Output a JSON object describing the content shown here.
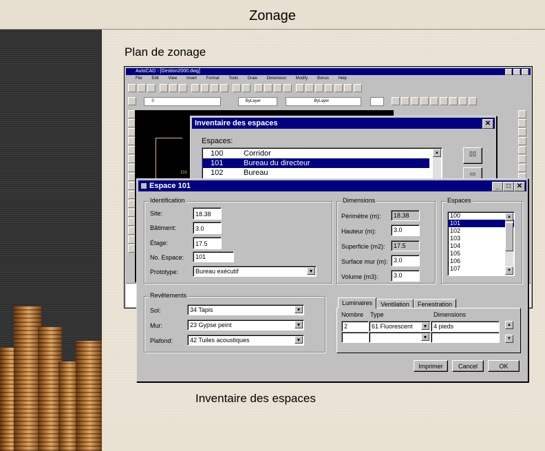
{
  "slide": {
    "title": "Zonage",
    "plan_label": "Plan de zonage",
    "bottom_label": "Inventaire des espaces"
  },
  "autocad": {
    "title": "AutoCAD - [Gestion2000.dwg]",
    "menu": [
      "File",
      "Edit",
      "View",
      "Insert",
      "Format",
      "Tools",
      "Draw",
      "Dimension",
      "Modify",
      "Bonus",
      "Help"
    ],
    "layer_value": "0",
    "linetype_value": "ByLayer",
    "linetype2_value": "ByLayer",
    "color_value": "ByLayer",
    "room_number": "101"
  },
  "inventaire": {
    "title": "Inventaire des espaces",
    "espaces_label": "Espaces:",
    "rows": [
      {
        "num": "100",
        "name": "Corridor"
      },
      {
        "num": "101",
        "name": "Bureau du directeur"
      },
      {
        "num": "102",
        "name": "Bureau"
      }
    ],
    "selected_index": 1
  },
  "espace": {
    "title": "Espace 101",
    "identification": {
      "title": "Identification",
      "site_label": "Site:",
      "site_value": "18.38",
      "batiment_label": "Bâtiment:",
      "batiment_value": "3.0",
      "etage_label": "Étage:",
      "etage_value": "17.5",
      "no_espace_label": "No. Espace:",
      "no_espace_value": "101",
      "prototype_label": "Prototype:",
      "prototype_value": "Bureau exécutif"
    },
    "dimensions": {
      "title": "Dimensions",
      "perimetre_label": "Périmètre (m):",
      "perimetre_value": "18.38",
      "hauteur_label": "Hauteur (m):",
      "hauteur_value": "3.0",
      "superficie_label": "Superficie (m2):",
      "superficie_value": "17.5",
      "surface_mur_label": "Surface mur (m):",
      "surface_mur_value": "3.0",
      "volume_label": "Volume (m3):",
      "volume_value": "3.0"
    },
    "espaces": {
      "title": "Espaces",
      "items": [
        "100",
        "101",
        "102",
        "103",
        "104",
        "105",
        "106",
        "107"
      ],
      "selected_index": 1
    },
    "revetements": {
      "title": "Revêtements",
      "sol_label": "Sol:",
      "sol_value": "34 Tapis",
      "mur_label": "Mur:",
      "mur_value": "23 Gypse peint",
      "plafond_label": "Plafond:",
      "plafond_value": "42 Tuiles acoustiques"
    },
    "tabs": [
      "Luminaires",
      "Ventilation",
      "Fenestration"
    ],
    "active_tab": 0,
    "luminaires": {
      "col_nombre": "Nombre",
      "col_type": "Type",
      "col_dimensions": "Dimensions",
      "row1_nombre": "2",
      "row1_type": "61 Fluorescent",
      "row1_dimensions": "4 pieds"
    },
    "buttons": {
      "imprimer": "Imprimer",
      "cancel": "Cancel",
      "ok": "OK"
    }
  }
}
